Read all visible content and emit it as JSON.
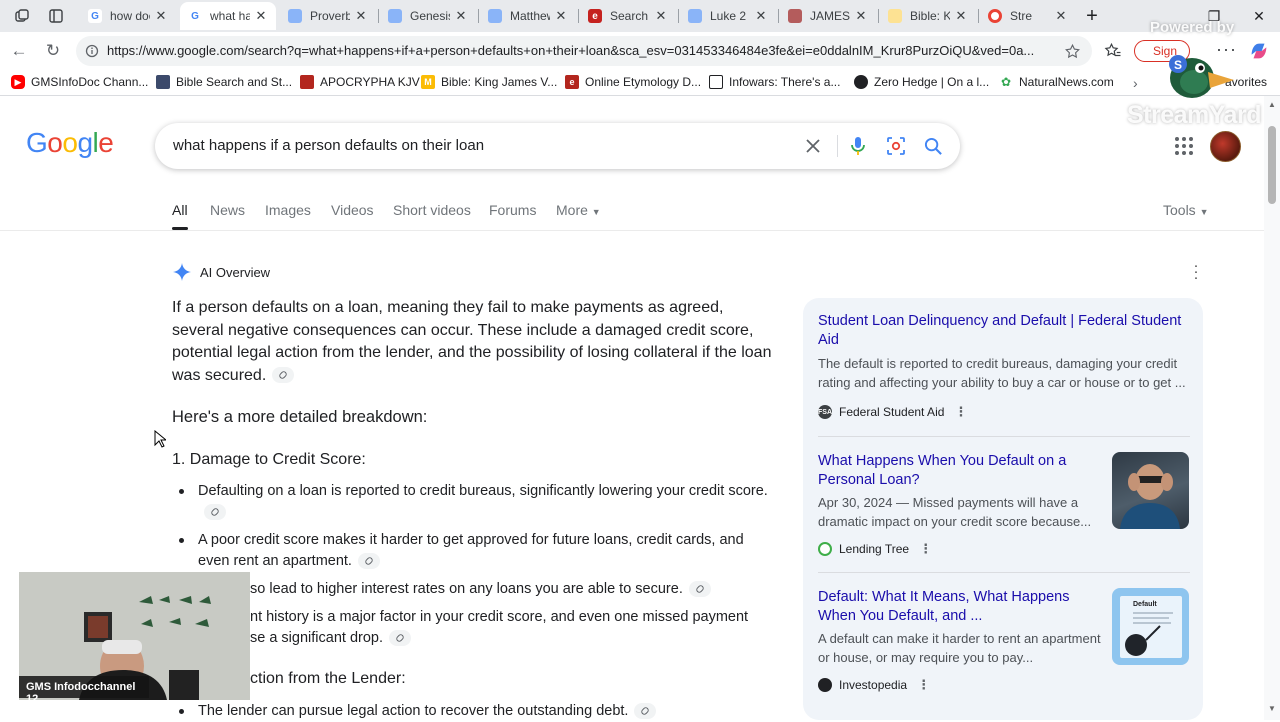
{
  "browser": {
    "tabs": [
      {
        "label": "how doe",
        "favicon": "google-icon"
      },
      {
        "label": "what ha",
        "favicon": "google-icon",
        "active": true
      },
      {
        "label": "Proverb",
        "favicon": "page-icon"
      },
      {
        "label": "Genesis",
        "favicon": "page-icon"
      },
      {
        "label": "Matthew",
        "favicon": "page-icon"
      },
      {
        "label": "Search",
        "favicon": "e-icon"
      },
      {
        "label": "Luke 2",
        "favicon": "page-icon"
      },
      {
        "label": "JAMES",
        "favicon": "book-icon"
      },
      {
        "label": "Bible: Ki",
        "favicon": "bible-icon"
      },
      {
        "label": "Stre",
        "favicon": "record-icon"
      }
    ],
    "url": "https://www.google.com/search?q=what+happens+if+a+person+defaults+on+their+loan&sca_esv=031453346484e3fe&ei=e0ddalnIM_Krur8PurzOiQU&ved=0a...",
    "sign_in": "Sign",
    "bookmarks": [
      {
        "label": "GMSInfoDoc Chann...",
        "icon": "youtube-icon"
      },
      {
        "label": "Bible Search and St...",
        "icon": "person-icon"
      },
      {
        "label": "APOCRYPHA KJV",
        "icon": "book-icon"
      },
      {
        "label": "Bible: King James V...",
        "icon": "m-icon"
      },
      {
        "label": "Online Etymology D...",
        "icon": "e-icon"
      },
      {
        "label": "Infowars: There's a...",
        "icon": "infowars-icon"
      },
      {
        "label": "Zero Hedge | On a l...",
        "icon": "zerohedge-icon"
      },
      {
        "label": "NaturalNews.com",
        "icon": "leaf-icon"
      }
    ],
    "favorites_label": "avorites"
  },
  "google": {
    "logo": "Google",
    "query": "what happens if a person defaults on their loan",
    "tabs": [
      "All",
      "News",
      "Images",
      "Videos",
      "Short videos",
      "Forums",
      "More"
    ],
    "tools": "Tools"
  },
  "ai_overview": {
    "heading": "AI Overview",
    "intro": "If a person defaults on a loan, meaning they fail to make payments as agreed, several negative consequences can occur. These include a damaged credit score, potential legal action from the lender, and the possibility of losing collateral if the loan was secured.",
    "breakdown_heading": "Here's a more detailed breakdown:",
    "section1": "1. Damage to Credit Score:",
    "bullets": [
      "Defaulting on a loan is reported to credit bureaus, significantly lowering your credit score.",
      "A poor credit score makes it harder to get approved for future loans, credit cards, and even rent an apartment.",
      "so lead to higher interest rates on any loans you are able to secure.",
      "nt history is a major factor in your credit score, and even one missed payment",
      "se a significant drop."
    ],
    "section2": "ction from the Lender:",
    "bullet_last": "The lender can pursue legal action to recover the outstanding debt."
  },
  "sources": [
    {
      "title": "Student Loan Delinquency and Default | Federal Student Aid",
      "desc": "The default is reported to credit bureaus, damaging your credit rating and affecting your ability to buy a car or house or to get ...",
      "site": "Federal Student Aid",
      "site_icon": "FSA"
    },
    {
      "title": "What Happens When You Default on a Personal Loan?",
      "desc": "Apr 30, 2024 — Missed payments will have a dramatic impact on your credit score because...",
      "site": "Lending Tree"
    },
    {
      "title": "Default: What It Means, What Happens When You Default, and ...",
      "desc": "A default can make it harder to rent an apartment or house, or may require you to pay...",
      "site": "Investopedia",
      "thumb_text": "Default"
    }
  ],
  "overlay": {
    "powered_by": "Powered by",
    "streamyard": "StreamYard",
    "webcam_caption": "GMS Infodocchannel 12"
  },
  "colors": {
    "link": "#1a0dab",
    "google_blue": "#4285f4",
    "google_red": "#ea4335",
    "google_yellow": "#fbbc05",
    "google_green": "#34a853"
  }
}
